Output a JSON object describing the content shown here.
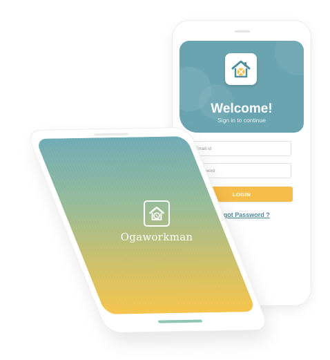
{
  "login_screen": {
    "welcome_title": "Welcome!",
    "subtitle": "Sign in to continue",
    "email_placeholder": "Email id",
    "password_placeholder": "Password",
    "login_label": "LOGIN",
    "forgot_label": "Forgot Password ?"
  },
  "splash_screen": {
    "brand": "Ogaworkman"
  },
  "colors": {
    "header_teal": "#6aa4b1",
    "accent_yellow": "#f6bd4a",
    "link_teal": "#4c8a98"
  },
  "icons": {
    "app_logo": "house-tools-icon",
    "splash_logo": "house-tools-icon"
  }
}
